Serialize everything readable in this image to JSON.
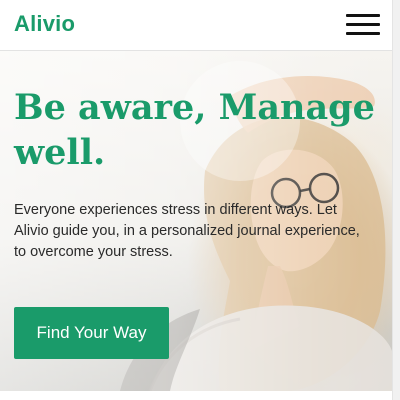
{
  "colors": {
    "brand": "#1a9b6a",
    "button": "#1a9b6a",
    "button_text": "#ffffff"
  },
  "nav": {
    "logo": "Alivio",
    "menu_icon": "hamburger-menu-icon"
  },
  "hero": {
    "headline": "Be aware, Manage well.",
    "description": "Everyone experiences stress in different ways. Let Alivio guide you, in a personalized journal experience, to overcome your stress.",
    "cta_label": "Find Your Way",
    "image_subject": "woman-with-glasses-relaxing"
  }
}
